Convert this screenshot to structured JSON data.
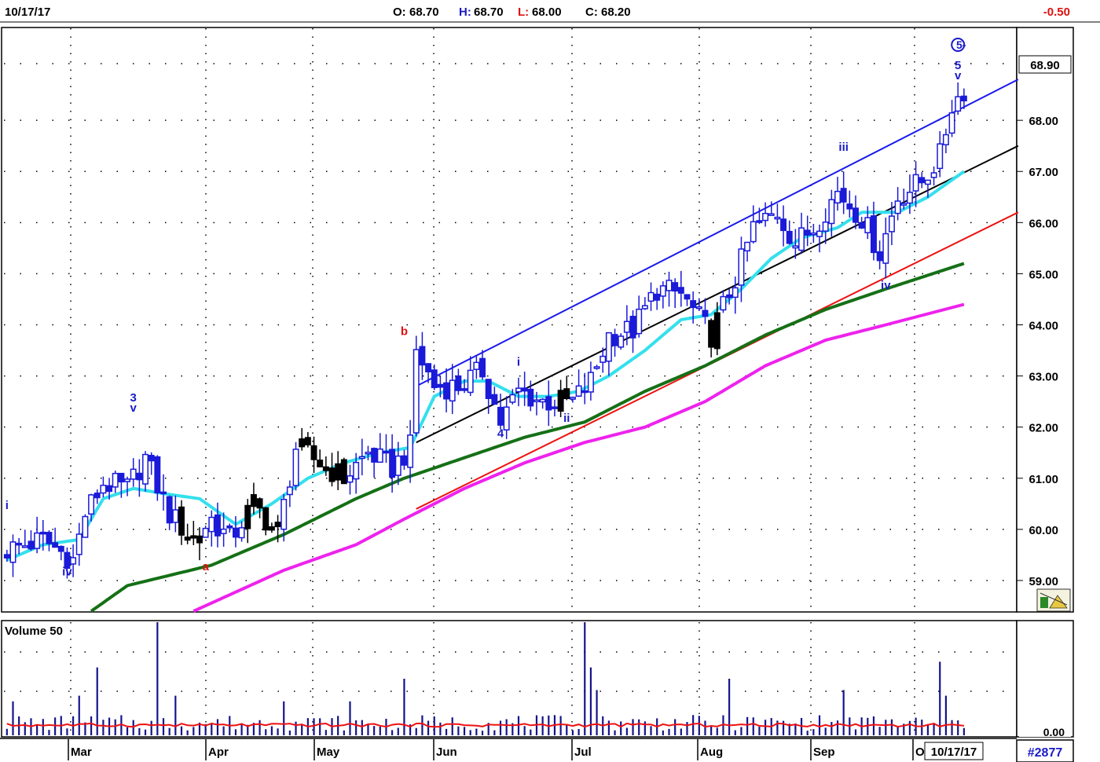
{
  "header": {
    "date": "10/17/17",
    "open_label": "O:",
    "open": "68.70",
    "high_label": "H:",
    "high": "68.70",
    "low_label": "L:",
    "low": "68.00",
    "close_label": "C:",
    "close": "68.20",
    "change": "-0.50"
  },
  "colors": {
    "ma_fast": "#33e0ec",
    "ma_mid": "#157016",
    "ma_slow": "#ee22ee",
    "channel_upper": "#1a1aee",
    "channel_mid": "#000000",
    "channel_lower": "#ee1111",
    "bull_candle": "#1a1ad8",
    "bear_candle": "#000000",
    "volume_bar": "#14148c",
    "volume_avg": "#ee1111",
    "wave_label_blue": "#1a1ac8",
    "wave_label_red": "#dd1111"
  },
  "chart_data": {
    "type": "candlestick",
    "price_axis": {
      "ylim": [
        58.4,
        69.8
      ],
      "ticks": [
        "59.00",
        "60.00",
        "61.00",
        "62.00",
        "63.00",
        "64.00",
        "65.00",
        "66.00",
        "67.00",
        "68.00"
      ],
      "last_price": "68.90"
    },
    "x_labels": [
      "Mar",
      "Apr",
      "May",
      "Jun",
      "Jul",
      "Aug",
      "Sep",
      "O"
    ],
    "date_box": "10/17/17",
    "chart_id": "#2877",
    "volume_panel": {
      "title": "Volume 50",
      "tick": "0.00"
    },
    "n_bars": 168,
    "ohlc_anchors": [
      [
        0,
        59.6
      ],
      [
        6,
        59.8
      ],
      [
        11,
        59.4
      ],
      [
        13,
        60.3
      ],
      [
        16,
        60.9
      ],
      [
        20,
        60.8
      ],
      [
        23,
        61.4
      ],
      [
        27,
        60.3
      ],
      [
        31,
        59.8
      ],
      [
        34,
        60.2
      ],
      [
        37,
        59.8
      ],
      [
        41,
        60.5
      ],
      [
        45,
        59.9
      ],
      [
        48,
        61.6
      ],
      [
        52,
        61.3
      ],
      [
        56,
        61.0
      ],
      [
        60,
        61.5
      ],
      [
        64,
        61.2
      ],
      [
        67,
        61.6
      ],
      [
        68,
        63.5
      ],
      [
        71,
        62.8
      ],
      [
        75,
        62.8
      ],
      [
        79,
        63.1
      ],
      [
        82,
        62.1
      ],
      [
        85,
        62.7
      ],
      [
        89,
        62.5
      ],
      [
        94,
        62.5
      ],
      [
        97,
        62.9
      ],
      [
        100,
        63.8
      ],
      [
        104,
        63.9
      ],
      [
        108,
        64.7
      ],
      [
        112,
        64.6
      ],
      [
        117,
        63.8
      ],
      [
        121,
        64.9
      ],
      [
        124,
        65.9
      ],
      [
        128,
        66.2
      ],
      [
        131,
        65.6
      ],
      [
        134,
        65.9
      ],
      [
        138,
        66.6
      ],
      [
        142,
        66.1
      ],
      [
        145,
        65.4
      ],
      [
        148,
        66.5
      ],
      [
        152,
        66.8
      ],
      [
        155,
        67.3
      ],
      [
        157,
        68.3
      ],
      [
        159,
        68.6
      ]
    ],
    "moving_averages": [
      {
        "name": "",
        "color_key": "ma_fast",
        "points": [
          [
            0,
            59.4
          ],
          [
            6,
            59.7
          ],
          [
            12,
            59.8
          ],
          [
            16,
            60.6
          ],
          [
            21,
            60.8
          ],
          [
            26,
            60.7
          ],
          [
            32,
            60.6
          ],
          [
            38,
            60.1
          ],
          [
            44,
            60.5
          ],
          [
            50,
            61.0
          ],
          [
            56,
            61.3
          ],
          [
            62,
            61.5
          ],
          [
            67,
            61.6
          ],
          [
            71,
            62.6
          ],
          [
            76,
            62.9
          ],
          [
            80,
            62.9
          ],
          [
            85,
            62.6
          ],
          [
            90,
            62.6
          ],
          [
            95,
            62.7
          ],
          [
            100,
            63.0
          ],
          [
            106,
            63.5
          ],
          [
            112,
            64.1
          ],
          [
            117,
            64.2
          ],
          [
            122,
            64.7
          ],
          [
            127,
            65.3
          ],
          [
            132,
            65.7
          ],
          [
            138,
            65.9
          ],
          [
            142,
            66.2
          ],
          [
            148,
            66.2
          ],
          [
            153,
            66.5
          ],
          [
            159,
            67.0
          ]
        ]
      },
      {
        "name": "",
        "color_key": "ma_mid",
        "points": [
          [
            14,
            58.4
          ],
          [
            20,
            58.9
          ],
          [
            34,
            59.3
          ],
          [
            46,
            59.9
          ],
          [
            58,
            60.6
          ],
          [
            66,
            61.0
          ],
          [
            76,
            61.4
          ],
          [
            86,
            61.8
          ],
          [
            96,
            62.1
          ],
          [
            106,
            62.7
          ],
          [
            116,
            63.2
          ],
          [
            126,
            63.8
          ],
          [
            136,
            64.3
          ],
          [
            146,
            64.7
          ],
          [
            159,
            65.2
          ]
        ]
      },
      {
        "name": "",
        "color_key": "ma_slow",
        "points": [
          [
            31,
            58.4
          ],
          [
            46,
            59.2
          ],
          [
            58,
            59.7
          ],
          [
            66,
            60.2
          ],
          [
            76,
            60.8
          ],
          [
            86,
            61.3
          ],
          [
            96,
            61.7
          ],
          [
            106,
            62.0
          ],
          [
            116,
            62.5
          ],
          [
            126,
            63.2
          ],
          [
            136,
            63.7
          ],
          [
            146,
            64.0
          ],
          [
            159,
            64.4
          ]
        ]
      }
    ],
    "trend_lines": [
      {
        "color_key": "channel_upper",
        "from": [
          68,
          62.8
        ],
        "to": [
          168,
          68.8
        ]
      },
      {
        "color_key": "channel_mid",
        "from": [
          68,
          61.7
        ],
        "to": [
          168,
          67.5
        ]
      },
      {
        "color_key": "channel_lower",
        "from": [
          68,
          60.4
        ],
        "to": [
          168,
          66.2
        ]
      }
    ],
    "wave_labels": [
      {
        "text": "i",
        "x": 0,
        "y": 60.4,
        "color_key": "wave_label_blue"
      },
      {
        "text": "iv",
        "x": 10,
        "y": 59.1,
        "color_key": "wave_label_blue"
      },
      {
        "text": "3",
        "x": 21,
        "y": 62.5,
        "color_key": "wave_label_blue"
      },
      {
        "text": "v",
        "x": 21,
        "y": 62.3,
        "color_key": "wave_label_blue"
      },
      {
        "text": "a",
        "x": 33,
        "y": 59.2,
        "color_key": "wave_label_red"
      },
      {
        "text": "b",
        "x": 66,
        "y": 63.8,
        "color_key": "wave_label_red"
      },
      {
        "text": "4",
        "x": 82,
        "y": 61.8,
        "color_key": "wave_label_blue"
      },
      {
        "text": "i",
        "x": 85,
        "y": 63.2,
        "color_key": "wave_label_blue"
      },
      {
        "text": "ii",
        "x": 93,
        "y": 62.1,
        "color_key": "wave_label_blue"
      },
      {
        "text": "iii",
        "x": 139,
        "y": 67.4,
        "color_key": "wave_label_blue"
      },
      {
        "text": "iv",
        "x": 146,
        "y": 64.7,
        "color_key": "wave_label_blue"
      },
      {
        "text": "5",
        "x": 158,
        "y": 69.0,
        "color_key": "wave_label_blue"
      },
      {
        "text": "v",
        "x": 158,
        "y": 68.8,
        "color_key": "wave_label_blue"
      }
    ],
    "top_marker": {
      "text": "5-",
      "x": 158,
      "y": 69.4
    },
    "volume": {
      "avg_level": 0.09,
      "spikes": [
        [
          1,
          0.3
        ],
        [
          12,
          0.35
        ],
        [
          15,
          0.6
        ],
        [
          25,
          1.0
        ],
        [
          28,
          0.35
        ],
        [
          46,
          0.3
        ],
        [
          57,
          0.3
        ],
        [
          66,
          0.5
        ],
        [
          96,
          1.0
        ],
        [
          97,
          0.6
        ],
        [
          98,
          0.4
        ],
        [
          120,
          0.5
        ],
        [
          139,
          0.4
        ],
        [
          155,
          0.65
        ],
        [
          156,
          0.35
        ]
      ]
    }
  }
}
